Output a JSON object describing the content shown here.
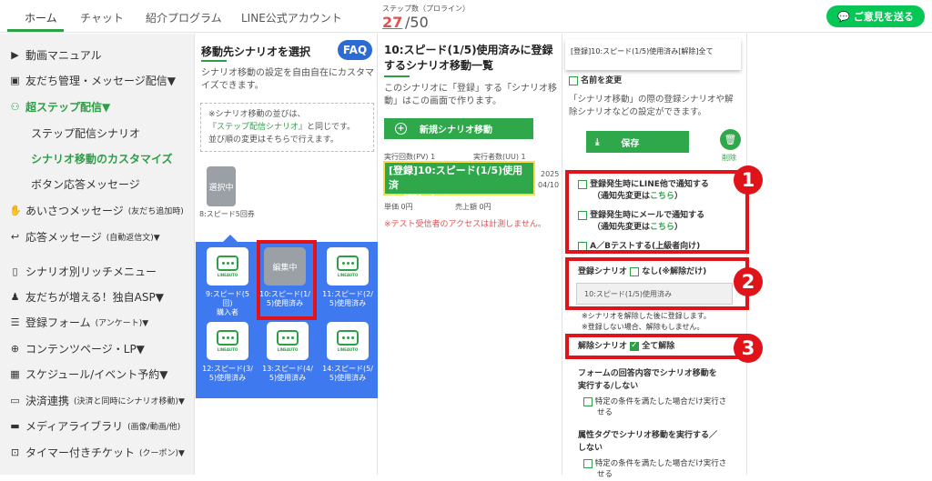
{
  "header": {
    "tabs": [
      "ホーム",
      "チャット",
      "紹介プログラム",
      "LINE公式アカウント"
    ],
    "step_label": "ステップ数（プロライン）",
    "step_current": "27",
    "step_max": "/50",
    "feedback_label": "ご意見を送る"
  },
  "sidebar": {
    "items": [
      {
        "label": "動画マニュアル"
      },
      {
        "label": "友だち管理・メッセージ配信▼"
      },
      {
        "label": "超ステップ配信▼"
      },
      {
        "label": "ステップ配信シナリオ"
      },
      {
        "label": "シナリオ移動のカスタマイズ"
      },
      {
        "label": "ボタン応答メッセージ"
      },
      {
        "label": "あいさつメッセージ",
        "small": "(友だち追加時)"
      },
      {
        "label": "応答メッセージ",
        "small": "(自動返信文)▼"
      },
      {
        "label": "シナリオ別リッチメニュー"
      },
      {
        "label": "友だちが増える！独自ASP▼"
      },
      {
        "label": "登録フォーム",
        "small": "(アンケート)▼"
      },
      {
        "label": "コンテンツページ・LP▼"
      },
      {
        "label": "スケジュール/イベント予約▼"
      },
      {
        "label": "決済連携",
        "small": "(決済と同時にシナリオ移動)▼"
      },
      {
        "label": "メディアライブラリ",
        "small": "(画像/動画/他)"
      },
      {
        "label": "タイマー付きチケット",
        "small": "(クーポン)▼"
      }
    ]
  },
  "column2": {
    "title": "移動先シナリオを選択",
    "faq": "FAQ",
    "desc1": "シナリオ移動の設定を自由自在にカスタマ",
    "desc2": "イズできます。",
    "note1": "※シナリオ移動の並びは、",
    "note2a": "『",
    "note2link": "ステップ配信シナリオ",
    "note2b": "』と同じです。",
    "note3": "並び順の変更はそちらで行えます。",
    "selected_label": "選択中",
    "selected_caption": "8:スピード5回券",
    "edit_label": "編集中",
    "logo_text": "LINEAUTO",
    "cards": [
      {
        "l1": "9:スピード(5回)",
        "l2": "購入者"
      },
      {
        "l1": "10:スピード(1/",
        "l2": "5)使用済み"
      },
      {
        "l1": "11:スピード(2/",
        "l2": "5)使用済み"
      },
      {
        "l1": "12:スピード(3/",
        "l2": "5)使用済み"
      },
      {
        "l1": "13:スピード(4/",
        "l2": "5)使用済み"
      },
      {
        "l1": "14:スピード(5/",
        "l2": "5)使用済み"
      }
    ]
  },
  "column3": {
    "title1": "10:スピード(1/5)使用済みに登録",
    "title2": "するシナリオ移動一覧",
    "desc1": "このシナリオに「登録」する「シナリオ移",
    "desc2": "動」はこの画面で作ります。",
    "new_button": "新規シナリオ移動",
    "pv_label": "実行回数(PV) 1",
    "uu_label": "実行者数(UU) 1",
    "scenario_line1": "[登録]10:スピード(1/5)使用済",
    "scenario_line2": "み[解除]全て",
    "date1": "2025",
    "date2": "04/10",
    "unit_price": "単価 0円",
    "sales": "売上額 0円",
    "warning": "※テスト受信者のアクセスは計測しません。"
  },
  "column4": {
    "header_title": "[登録]10:スピード(1/5)使用済み[解除]全て",
    "rename": "名前を変更",
    "desc1": "「シナリオ移動」の際の登録シナリオや解",
    "desc2": "除シナリオなどの設定ができます。",
    "save": "保存",
    "delete": "削除",
    "notify_line": "登録発生時にLINE他で通知する",
    "notify_line_sub": "（通知先変更は",
    "here": "こちら",
    "close_paren": "）",
    "notify_mail": "登録発生時にメールで通知する",
    "ab_test": "A／Bテストする(上級者向け)",
    "reg_scenario_label": "登録シナリオ",
    "none_label": "なし(※解除だけ)",
    "reg_scenario_value": "10:スピード(1/5)使用済み",
    "note1": "※シナリオを解除した後に登録します。",
    "note2": "※登録しない場合、解除もしません。",
    "release_label": "解除シナリオ",
    "release_all": "全て解除",
    "form_title1": "フォームの回答内容でシナリオ移動を",
    "form_title2": "実行する/しない",
    "condition1": "特定の条件を満たした場合だけ実行さ",
    "condition2": "せる",
    "tag_title1": "属性タグでシナリオ移動を実行する／",
    "tag_title2": "しない",
    "condition3": "特定の条件を満たした場合だけ実行さ",
    "condition4": "せる"
  },
  "callouts": [
    "1",
    "2",
    "3"
  ]
}
